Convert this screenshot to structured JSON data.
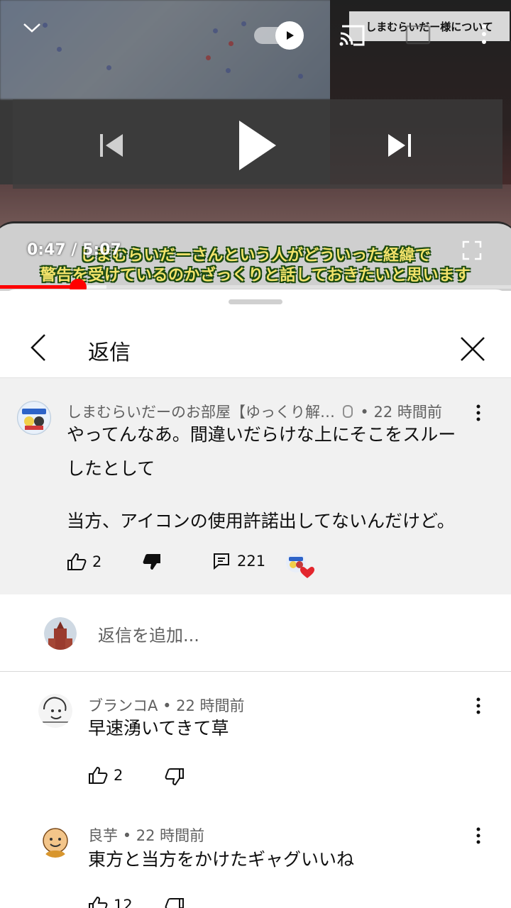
{
  "player": {
    "corner_banner": "しまむらいだー様について",
    "subtitle_line1": "しまむらいだーさんという人がどういった経緯で",
    "subtitle_line2": "警告を受けているのかざっくりと話しておきたいと思います",
    "time": "0:47 / 5:07",
    "progress": 0.153
  },
  "panel": {
    "title": "返信"
  },
  "parent_comment": {
    "author": "しまむらいだーのお部屋【ゆっくり解…",
    "separator": "•",
    "time": "22 時間前",
    "text_line1": "やってんなあ。間違いだらけな上にそこをスルー",
    "text_line2": "したとして",
    "text_line3": "当方、アイコンの使用許諾出してないんだけど。",
    "likes": "2",
    "replies": "221"
  },
  "reply_input": {
    "placeholder": "返信を追加..."
  },
  "replies": [
    {
      "author": "ブランコA",
      "time": "22 時間前",
      "text": "早速湧いてきて草",
      "likes": "2"
    },
    {
      "author": "良芋",
      "time": "22 時間前",
      "text": "東方と当方をかけたギャグいいね",
      "likes": "12"
    }
  ],
  "colors": {
    "accent": "#ff0000",
    "subtitle": "#f3e36a",
    "panel_gray": "#f1f1f1",
    "heart": "#e3262d"
  }
}
